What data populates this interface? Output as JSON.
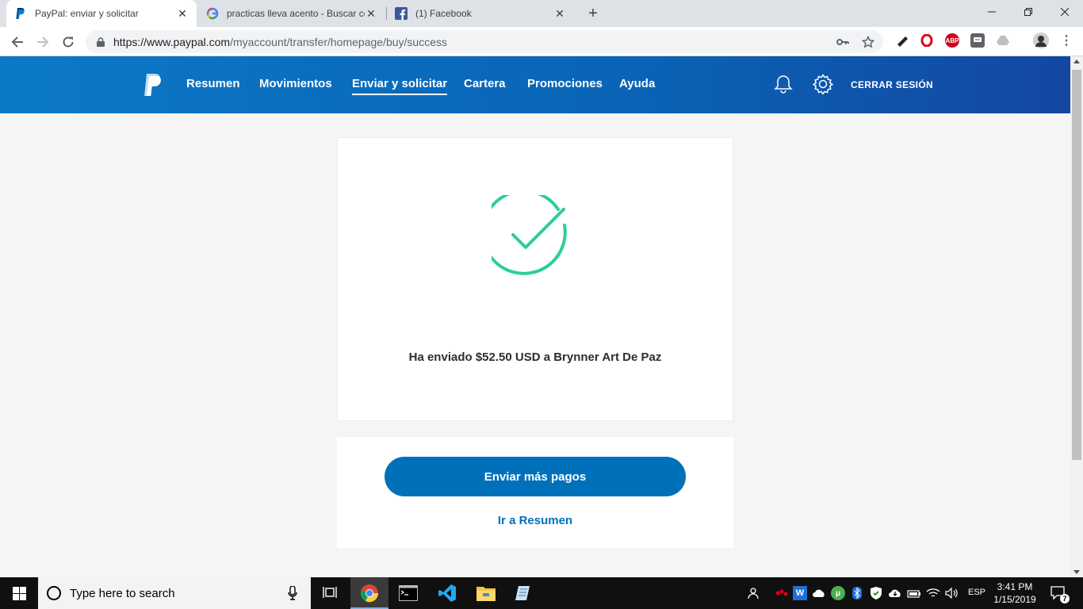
{
  "browser": {
    "tabs": [
      {
        "title": "PayPal: enviar y solicitar",
        "active": true
      },
      {
        "title": "practicas lleva acento - Buscar co",
        "active": false
      },
      {
        "title": "(1) Facebook",
        "active": false
      }
    ],
    "url_host": "https://www.paypal.com",
    "url_path": "/myaccount/transfer/homepage/buy/success"
  },
  "header": {
    "nav": [
      "Resumen",
      "Movimientos",
      "Enviar y solicitar",
      "Cartera",
      "Promociones",
      "Ayuda"
    ],
    "active_nav": "Enviar y solicitar",
    "logout": "CERRAR SESIÓN"
  },
  "success": {
    "message": "Ha enviado $52.50 USD a Brynner Art De Paz",
    "check_color": "#2dce96"
  },
  "actions": {
    "send_more": "Enviar más pagos",
    "go_summary": "Ir a Resumen"
  },
  "taskbar": {
    "search_placeholder": "Type here to search",
    "language": "ESP",
    "time": "3:41 PM",
    "date": "1/15/2019",
    "notification_count": "7"
  },
  "colors": {
    "paypal_blue": "#0070ba",
    "header_start": "#0b79c7",
    "header_end": "#1347a2"
  }
}
